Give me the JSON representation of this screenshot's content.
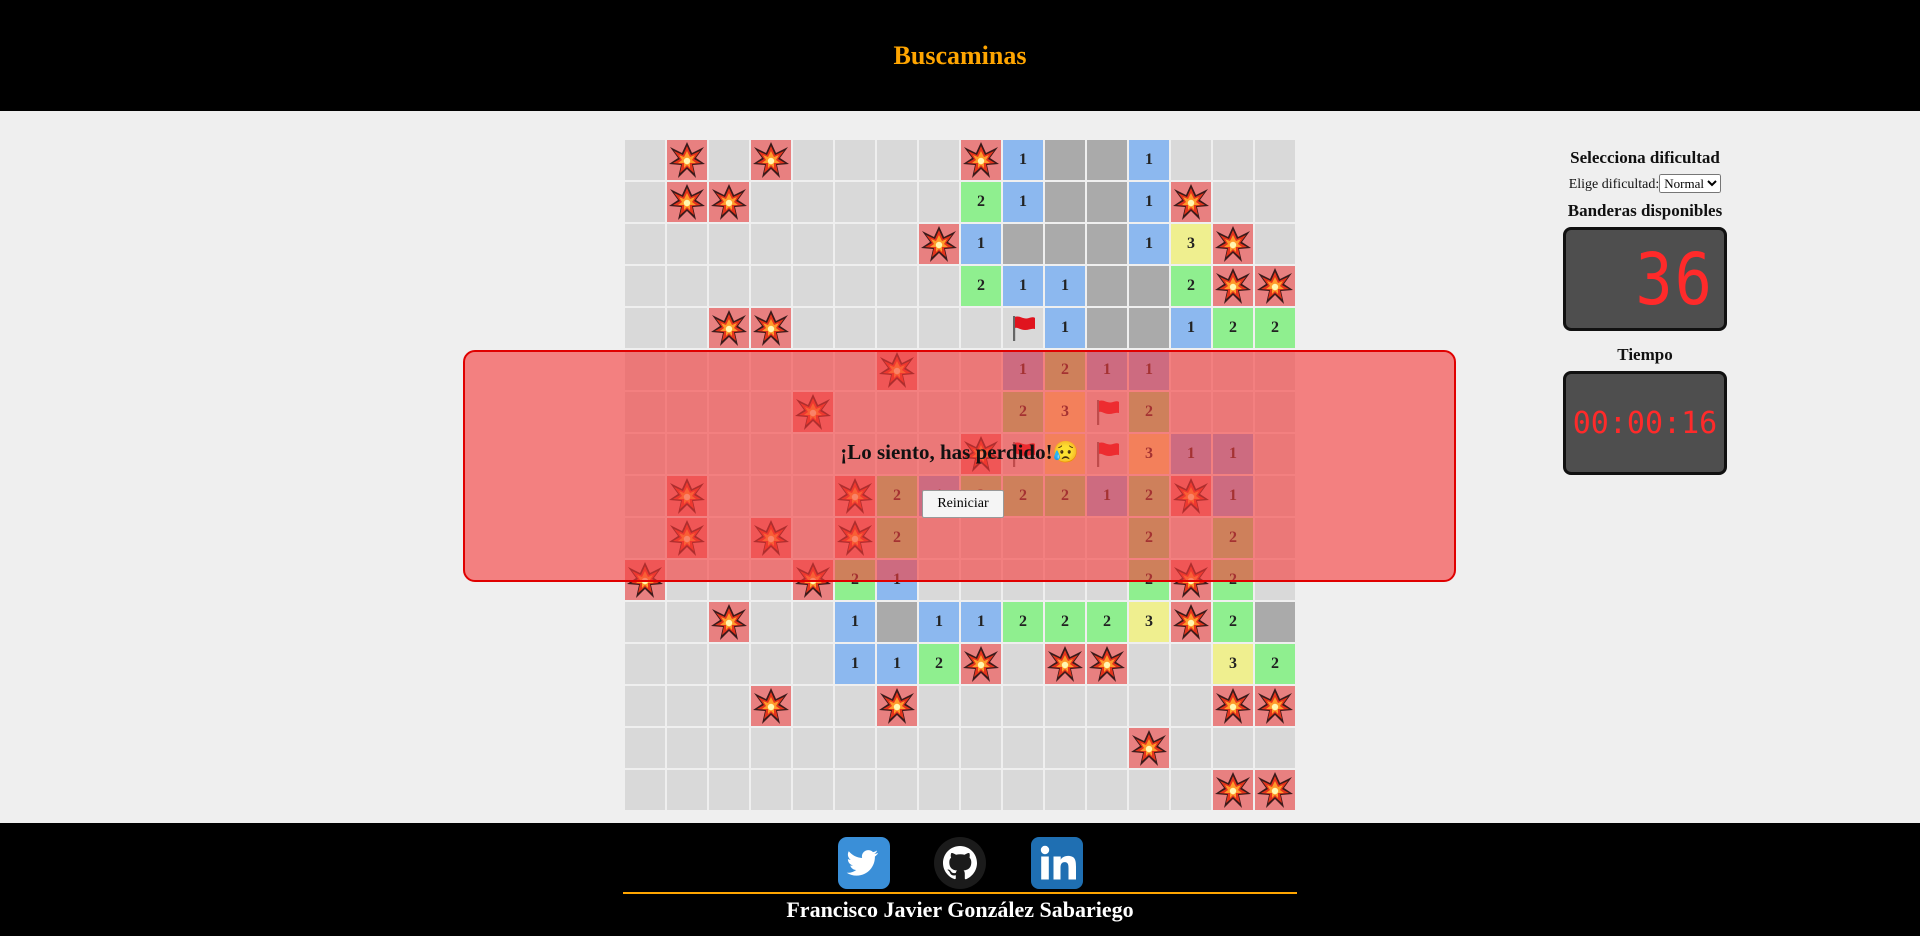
{
  "header": {
    "title": "Buscaminas"
  },
  "board": {
    "rows": [
      [
        "h",
        "m",
        "h",
        "m",
        "h",
        "h",
        "h",
        "h",
        "m",
        "1",
        "e",
        "e",
        "1",
        "h",
        "h",
        "h"
      ],
      [
        "h",
        "m",
        "m",
        "h",
        "h",
        "h",
        "h",
        "h",
        "2",
        "1",
        "e",
        "e",
        "1",
        "m",
        "h",
        "h"
      ],
      [
        "h",
        "h",
        "h",
        "h",
        "h",
        "h",
        "h",
        "m",
        "1",
        "e",
        "e",
        "e",
        "1",
        "3",
        "m",
        "h"
      ],
      [
        "h",
        "h",
        "h",
        "h",
        "h",
        "h",
        "h",
        "h",
        "2",
        "1",
        "1",
        "e",
        "e",
        "2",
        "m",
        "m"
      ],
      [
        "h",
        "h",
        "m",
        "m",
        "h",
        "h",
        "h",
        "h",
        "h",
        "f",
        "1",
        "e",
        "e",
        "1",
        "2",
        "2"
      ],
      [
        "h",
        "h",
        "h",
        "h",
        "h",
        "h",
        "m",
        "h",
        "h",
        "1",
        "2",
        "1",
        "1",
        "h",
        "h",
        "h"
      ],
      [
        "h",
        "h",
        "h",
        "h",
        "m",
        "h",
        "h",
        "h",
        "h",
        "2",
        "3",
        "f",
        "2",
        "h",
        "h",
        "h"
      ],
      [
        "h",
        "h",
        "h",
        "h",
        "h",
        "h",
        "h",
        "h",
        "m",
        "f",
        "3",
        "f",
        "3",
        "1",
        "1",
        "h"
      ],
      [
        "h",
        "m",
        "h",
        "h",
        "h",
        "m",
        "2",
        "1",
        "2",
        "2",
        "2",
        "1",
        "2",
        "m",
        "1",
        "h"
      ],
      [
        "h",
        "m",
        "h",
        "m",
        "h",
        "m",
        "2",
        "h",
        "h",
        "h",
        "h",
        "h",
        "2",
        "h",
        "2",
        "h"
      ],
      [
        "m",
        "h",
        "h",
        "h",
        "m",
        "2",
        "1",
        "h",
        "h",
        "h",
        "h",
        "h",
        "2",
        "m",
        "2",
        "h"
      ],
      [
        "h",
        "h",
        "m",
        "h",
        "h",
        "1",
        "e",
        "1",
        "1",
        "2",
        "2",
        "2",
        "3",
        "m",
        "2",
        "e"
      ],
      [
        "h",
        "h",
        "h",
        "h",
        "h",
        "1",
        "1",
        "2",
        "m",
        "h",
        "m",
        "m",
        "h",
        "h",
        "3",
        "2"
      ],
      [
        "h",
        "h",
        "h",
        "m",
        "h",
        "h",
        "m",
        "h",
        "h",
        "h",
        "h",
        "h",
        "h",
        "h",
        "m",
        "m"
      ],
      [
        "h",
        "h",
        "h",
        "h",
        "h",
        "h",
        "h",
        "h",
        "h",
        "h",
        "h",
        "h",
        "m",
        "h",
        "h",
        "h"
      ],
      [
        "h",
        "h",
        "h",
        "h",
        "h",
        "h",
        "h",
        "h",
        "h",
        "h",
        "h",
        "h",
        "h",
        "h",
        "m",
        "m"
      ]
    ]
  },
  "overlay": {
    "message": "¡Lo siento, has perdido!😥",
    "restart_label": "Reiniciar"
  },
  "sidebar": {
    "difficulty_title": "Selecciona dificultad",
    "difficulty_label": "Elige dificultad:",
    "difficulty_selected": "Normal",
    "flags_title": "Banderas disponibles",
    "flags_count": "36",
    "time_title": "Tiempo",
    "time_value": "00:00:16"
  },
  "footer": {
    "author": "Francisco Javier González Sabariego",
    "icons": [
      "twitter-icon",
      "github-icon",
      "linkedin-icon"
    ]
  },
  "colors": {
    "header_text": "#ffa500",
    "led_digits": "#ff2a2a",
    "overlay": "#f53c3c",
    "num1": "#8cb8ef",
    "num2": "#8fef8f",
    "num3": "#efef8f"
  }
}
